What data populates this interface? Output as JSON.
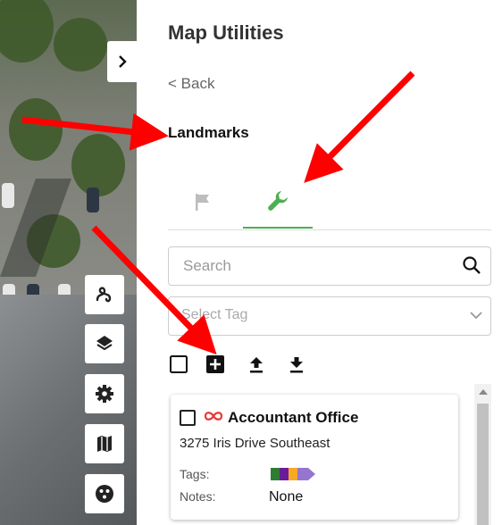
{
  "panel": {
    "title": "Map Utilities",
    "back_label": "< Back",
    "section_title": "Landmarks"
  },
  "tabs": [
    {
      "icon": "flag-icon",
      "active": false
    },
    {
      "icon": "wrench-icon",
      "active": true
    }
  ],
  "search": {
    "placeholder": "Search"
  },
  "tag_select": {
    "placeholder": "Select Tag"
  },
  "toolbar": {
    "icons": [
      "select-all-checkbox",
      "add-icon",
      "upload-icon",
      "download-icon"
    ]
  },
  "landmarks": [
    {
      "name": "Accountant Office",
      "address": "3275 Iris Drive Southeast",
      "tags_label": "Tags:",
      "notes_label": "Notes:",
      "notes": "None",
      "tag_colors": [
        "#2e7d32",
        "#6a1b9a",
        "#f9a825",
        "#9575cd"
      ]
    }
  ],
  "map_tools": [
    "route-icon",
    "layers-icon",
    "settings-icon",
    "map-icon",
    "palette-icon"
  ],
  "colors": {
    "accent_green": "#4caf50",
    "infinity_red": "#e53935",
    "annotation_red": "#ff0000"
  }
}
